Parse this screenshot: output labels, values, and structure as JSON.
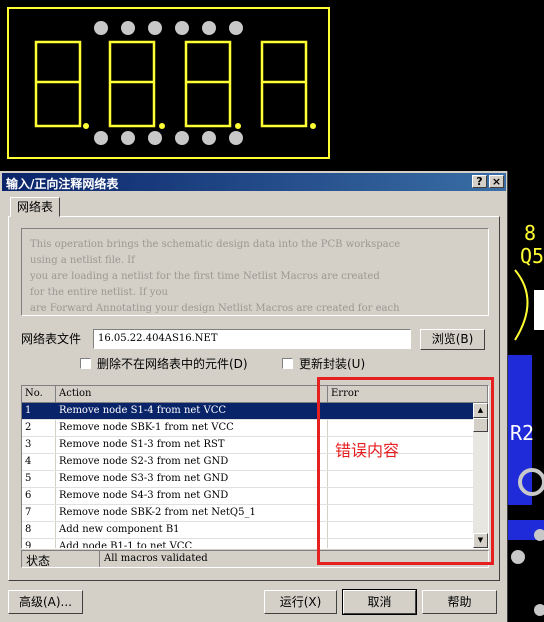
{
  "pcb": {
    "digit_glyph": "8",
    "right_labels": [
      "8",
      "Q5",
      "R2"
    ]
  },
  "dialog": {
    "title": "输入/正向注释网络表",
    "help_label": "?",
    "close_label": "×",
    "tab_label": "网络表",
    "description_lines": [
      "This operation brings the schematic design data into the PCB workspace",
      "using a netlist file. If",
      "you are loading a netlist for the first time Netlist Macros are created",
      "for the entire netlist. If you",
      "are Forward Annotating your design Netlist Macros are created for each"
    ],
    "netfile_label": "网络表文件",
    "netfile_value": "16.05.22.404AS16.NET",
    "browse_label": "浏览(B)",
    "delete_components_label": "删除不在网络表中的元件(D)",
    "update_footprint_label": "更新封装(U)",
    "columns": [
      "No.",
      "Action",
      "Error"
    ],
    "rows": [
      {
        "no": "1",
        "action": "Remove node S1-4 from net VCC",
        "error": ""
      },
      {
        "no": "2",
        "action": "Remove node SBK-1 from net VCC",
        "error": ""
      },
      {
        "no": "3",
        "action": "Remove node S1-3 from net RST",
        "error": ""
      },
      {
        "no": "4",
        "action": "Remove node S2-3 from net GND",
        "error": ""
      },
      {
        "no": "5",
        "action": "Remove node S3-3 from net GND",
        "error": ""
      },
      {
        "no": "6",
        "action": "Remove node S4-3 from net GND",
        "error": ""
      },
      {
        "no": "7",
        "action": "Remove node SBK-2 from net NetQ5_1",
        "error": ""
      },
      {
        "no": "8",
        "action": "Add new component B1",
        "error": ""
      },
      {
        "no": "9",
        "action": "Add node B1-1 to net VCC",
        "error": ""
      }
    ],
    "status_label": "状态",
    "status_value": "All macros validated",
    "advanced_label": "高级(A)...",
    "run_label": "运行(X)",
    "cancel_label": "取消",
    "help_button_label": "帮助"
  },
  "annotation": {
    "text": "错误内容",
    "color": "#e62020"
  },
  "colors": {
    "pcb_yellow": "#ffff33",
    "pad_gray": "#c8c8c8",
    "selection": "#0a246a"
  }
}
